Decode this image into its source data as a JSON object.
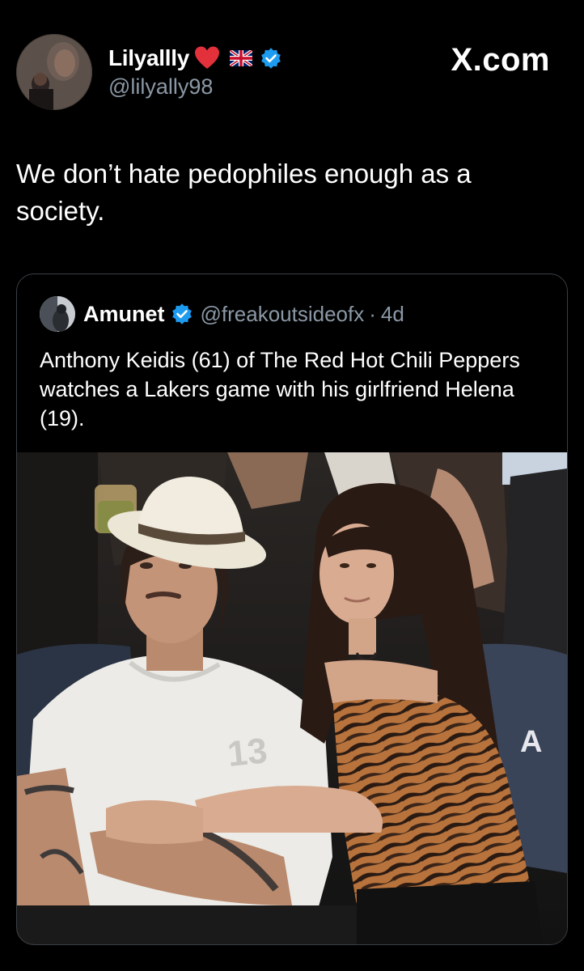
{
  "post": {
    "author": {
      "display_name": "Lilyallly",
      "handle": "@lilyally98",
      "name_emojis": [
        "red-heart",
        "uk-flag"
      ],
      "verified": true
    },
    "source_label": "X.com",
    "text": "We don’t hate pedophiles enough as a society."
  },
  "quoted_post": {
    "author": {
      "display_name": "Amunet",
      "handle": "@freakoutsideofx",
      "verified": true
    },
    "separator": "·",
    "timestamp": "4d",
    "text": "Anthony Keidis (61) of The Red Hot Chili Peppers watches a Lakers game with his girlfriend Helena (19).",
    "media": {
      "jersey_number": "13",
      "seat_letter": "A"
    }
  },
  "colors": {
    "background": "#000000",
    "text_primary": "#ffffff",
    "text_secondary": "#8b98a5",
    "verified_blue": "#1d9bf0",
    "card_border": "#3a3f44"
  }
}
